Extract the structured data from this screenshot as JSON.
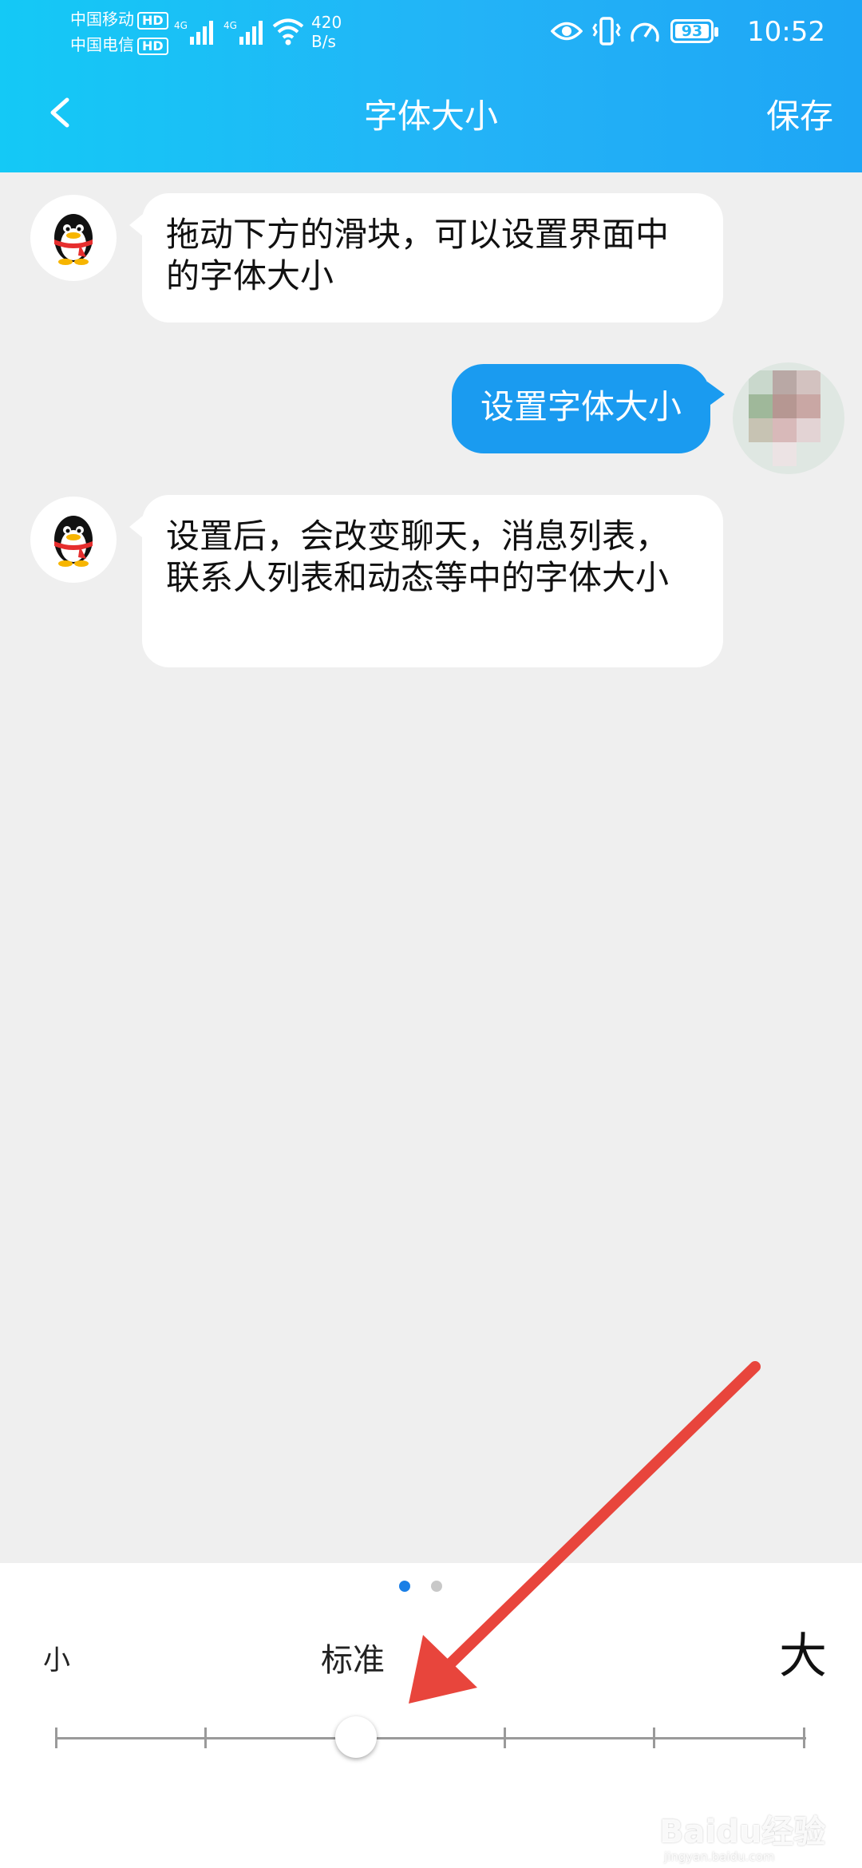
{
  "status_bar": {
    "carrier1": "中国移动",
    "carrier2": "中国电信",
    "hd": "HD",
    "net1": "4G",
    "net2": "4G",
    "speed_value": "420",
    "speed_unit": "B/s",
    "battery": "93",
    "time": "10:52",
    "icons": [
      "eye-icon",
      "vibrate-icon",
      "speedometer-icon",
      "wifi-icon",
      "signal-icon",
      "battery-icon"
    ]
  },
  "header": {
    "title": "字体大小",
    "save_label": "保存",
    "back_icon": "chevron-left-icon"
  },
  "messages": [
    {
      "from": "bot",
      "text": "拖动下方的滑块，可以设置界面中的字体大小"
    },
    {
      "from": "self",
      "text": "设置字体大小"
    },
    {
      "from": "bot",
      "text": "设置后，会改变聊天，消息列表，联系人列表和动态等中的字体大小"
    }
  ],
  "pager": {
    "pages": 2,
    "active": 1
  },
  "font_size_slider": {
    "label_small": "小",
    "label_standard": "标准",
    "label_large": "大",
    "steps": 6,
    "selected_index": 2
  },
  "watermark": {
    "text": "Baidu经验",
    "sub": "jingyan.baidu.com"
  },
  "colors": {
    "header_start": "#14c9f6",
    "header_end": "#1ea6f5",
    "outgoing_bubble": "#1a9bf0",
    "background": "#efefef",
    "annotation_arrow": "#e8453c"
  }
}
